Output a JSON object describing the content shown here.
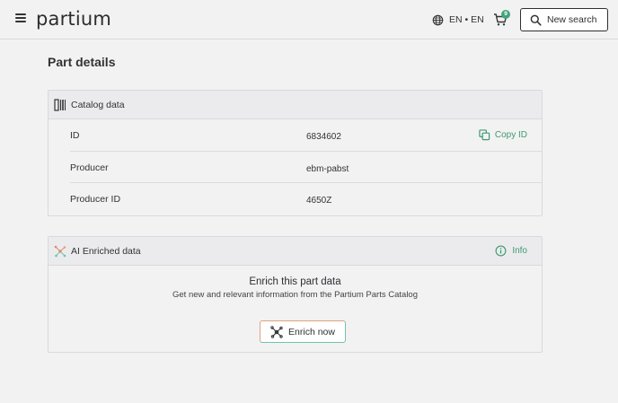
{
  "header": {
    "logo": "partium",
    "language": "EN • EN",
    "cart_count": "9",
    "new_search_label": "New search"
  },
  "page": {
    "title": "Part details"
  },
  "catalog": {
    "title": "Catalog data",
    "copy_label": "Copy ID",
    "rows": [
      {
        "label": "ID",
        "value": "6834602"
      },
      {
        "label": "Producer",
        "value": "ebm-pabst"
      },
      {
        "label": "Producer ID",
        "value": "4650Z"
      }
    ]
  },
  "ai": {
    "title": "AI Enriched data",
    "info_label": "Info",
    "enrich_title": "Enrich this part data",
    "enrich_subtitle": "Get new and relevant information from the Partium Parts Catalog",
    "enrich_button": "Enrich now"
  },
  "colors": {
    "accent_green": "#3e9a72",
    "badge_green": "#43a47a"
  }
}
